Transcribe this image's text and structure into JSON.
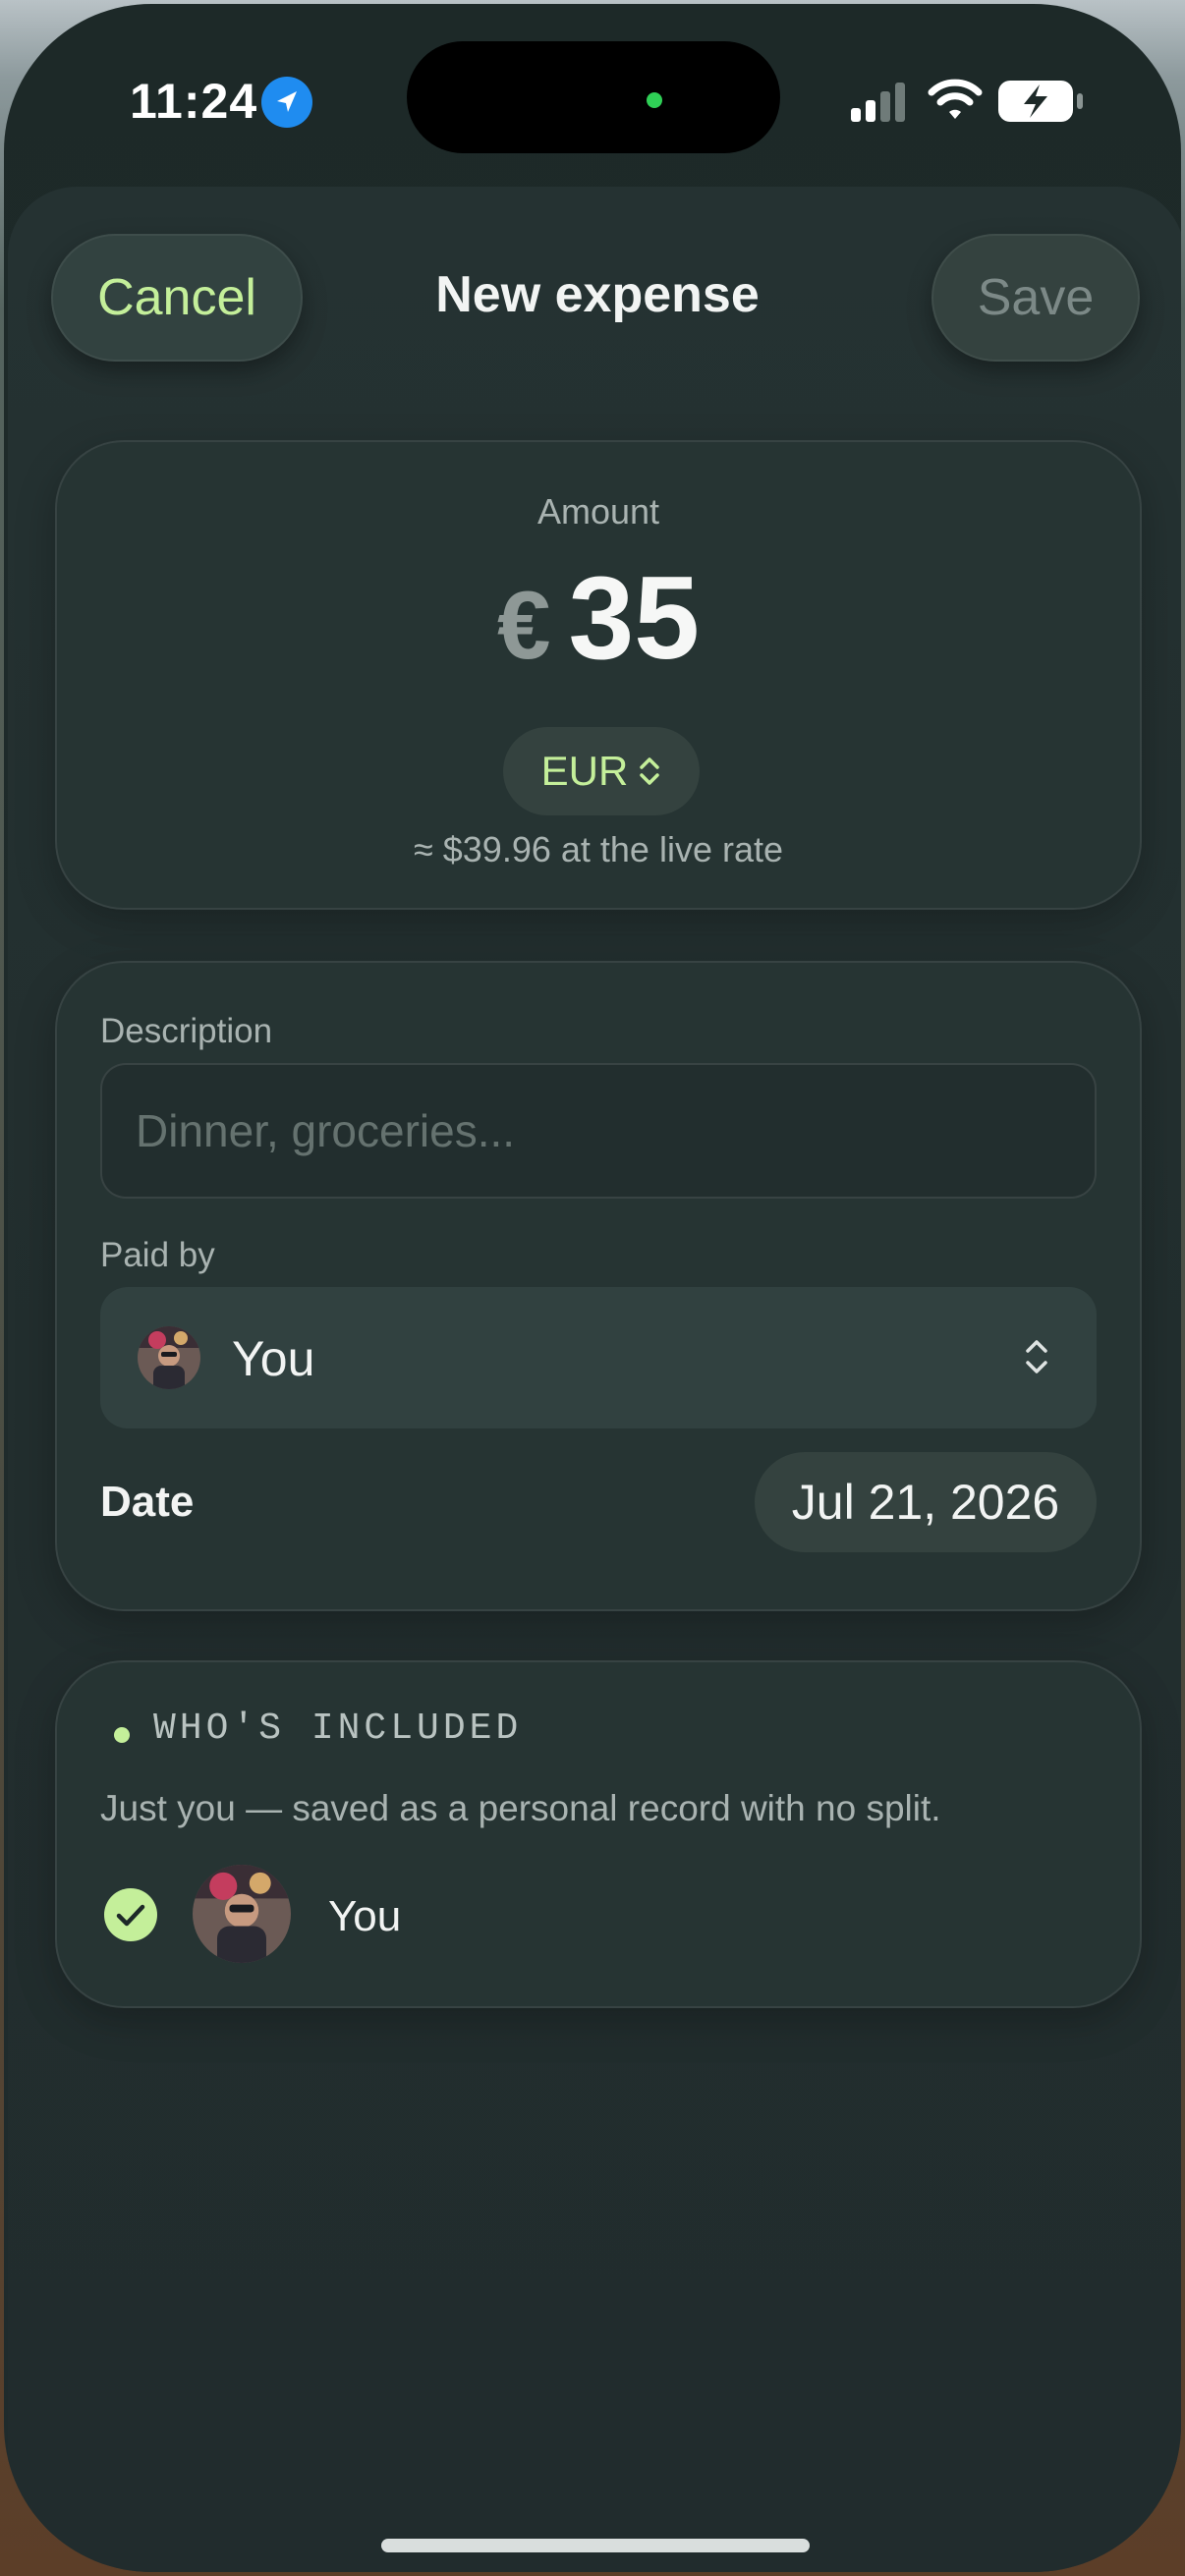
{
  "status_bar": {
    "time": "11:24",
    "location_icon": "location-arrow-icon",
    "signal_icon": "cellular-signal-icon",
    "wifi_icon": "wifi-icon",
    "battery_icon": "battery-charging-icon"
  },
  "header": {
    "cancel_label": "Cancel",
    "title": "New expense",
    "save_label": "Save"
  },
  "amount": {
    "label": "Amount",
    "symbol": "€",
    "value": "35",
    "currency_code": "EUR",
    "currency_icon": "chevron-up-down-icon",
    "rate_note": "≈ $39.96 at the live rate"
  },
  "details": {
    "description_label": "Description",
    "description_value": "",
    "description_placeholder": "Dinner, groceries...",
    "paid_by_label": "Paid by",
    "payer_name": "You",
    "payer_avatar_icon": "user-avatar",
    "payer_chevron_icon": "chevron-up-down-icon",
    "date_label": "Date",
    "date_value": "Jul 21, 2026"
  },
  "included": {
    "heading": "WHO'S INCLUDED",
    "note": "Just you — saved as a personal record with no split.",
    "members": [
      {
        "name": "You",
        "selected": true,
        "check_icon": "checkmark-circle-icon"
      }
    ]
  },
  "colors": {
    "accent": "#c4ef9a",
    "background": "#1f2b2b",
    "card": "#263433",
    "muted_text": "#a9b3b1",
    "location_blue": "#1f8cf0",
    "camera_dot": "#2fcf56"
  }
}
